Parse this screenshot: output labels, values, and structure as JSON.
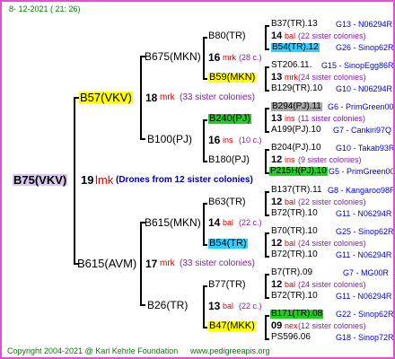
{
  "header": {
    "date": "8- 12-2021 ( 21: 26)"
  },
  "footer": {
    "copyright": "Copyright 2004-2021 @ Karl Kehrle Foundation",
    "website": "www.pedigreeapis.org"
  },
  "gen1": {
    "root": "B75(VKV)",
    "count": "19",
    "unit": "lmk",
    "drones": "(Drones from 12 sister colonies)"
  },
  "gen2": [
    {
      "name": "B57(VKV)",
      "count": "18",
      "unit": "mrk",
      "sisters": "(33 sister colonies)"
    },
    {
      "name": "B615(AVM)",
      "count": "17",
      "unit": "mrk",
      "sisters": "(33 sister colonies)"
    }
  ],
  "gen3": [
    {
      "name": "B675(MKN)"
    },
    {
      "name": "B100(PJ)"
    },
    {
      "name": "B615(MKN)"
    },
    {
      "name": "B26(TR)"
    }
  ],
  "gen4": [
    {
      "name": "B80(TR)",
      "count": "16",
      "unit": "mrk",
      "sisters": "(28 c.)"
    },
    {
      "name": "B59(MKN)",
      "count": "",
      "unit": "",
      "sisters": ""
    },
    {
      "name": "B240(PJ)",
      "count": "",
      "unit": "",
      "sisters": ""
    },
    {
      "name": "B180(PJ)",
      "count": "16",
      "unit": "ins",
      "sisters": "(10 c.)"
    },
    {
      "name": "B63(TR)",
      "count": "14",
      "unit": "bal",
      "sisters": "(22 c.)"
    },
    {
      "name": "B54(TR)",
      "count": "",
      "unit": "",
      "sisters": ""
    },
    {
      "name": "B77(TR)",
      "count": "13",
      "unit": "bal",
      "sisters": "(22 c.)"
    },
    {
      "name": "B47(MKK)",
      "count": "",
      "unit": "",
      "sisters": ""
    }
  ],
  "gen5": [
    {
      "name": "B37(TR).13",
      "code": "G13 - N06294R"
    },
    {
      "count": "14",
      "unit": "bal",
      "sisters": "(22 sister colonies)"
    },
    {
      "name": "B54(TR).12",
      "code": "G26 - Sinop62R"
    },
    {
      "name": "ST206.11.",
      "code": "G15 - SinopEgg86R"
    },
    {
      "count": "13",
      "unit": "mrk",
      "sisters": "(24 sister colonies)"
    },
    {
      "name": "B129(TR).10",
      "code": "G10 - N06294R"
    },
    {
      "name": "B294(PJ).11",
      "code": "G6 - PrimGreen00"
    },
    {
      "count": "13",
      "unit": "ins",
      "sisters": "(11 sister colonies)"
    },
    {
      "name": "A199(PJ).10",
      "code": "G7 - Cankiri97Q"
    },
    {
      "name": "B204(PJ).10",
      "code": "G10 - Takab93R"
    },
    {
      "count": "12",
      "unit": "ins",
      "sisters": "(9 sister colonies)"
    },
    {
      "name": "P215H(PJ).10",
      "code": "G5 - PrimGreen00"
    },
    {
      "name": "B137(TR).11",
      "code": "G8 - Kangaroo98R"
    },
    {
      "count": "12",
      "unit": "bal",
      "sisters": "(22 sister colonies)"
    },
    {
      "name": "B72(TR).10",
      "code": "G11 - N06294R"
    },
    {
      "name": "B70(TR).10",
      "code": "G25 - Sinop62R"
    },
    {
      "count": "12",
      "unit": "bal",
      "sisters": "(24 sister colonies)"
    },
    {
      "name": "B72(TR).10",
      "code": "G11 - N06294R"
    },
    {
      "name": "B7(TR).09",
      "code": "G7 - MG00R"
    },
    {
      "count": "12",
      "unit": "bal",
      "sisters": "(24 sister colonies)"
    },
    {
      "name": "B72(TR).10",
      "code": "G11 - N06294R"
    },
    {
      "name": "B171(TR).08",
      "code": "G22 - Sinop62R"
    },
    {
      "count": "09",
      "unit": "nex",
      "sisters": "(12 sister colonies)"
    },
    {
      "name": "PS596.06",
      "code": "G18 - Sinop72R"
    }
  ]
}
